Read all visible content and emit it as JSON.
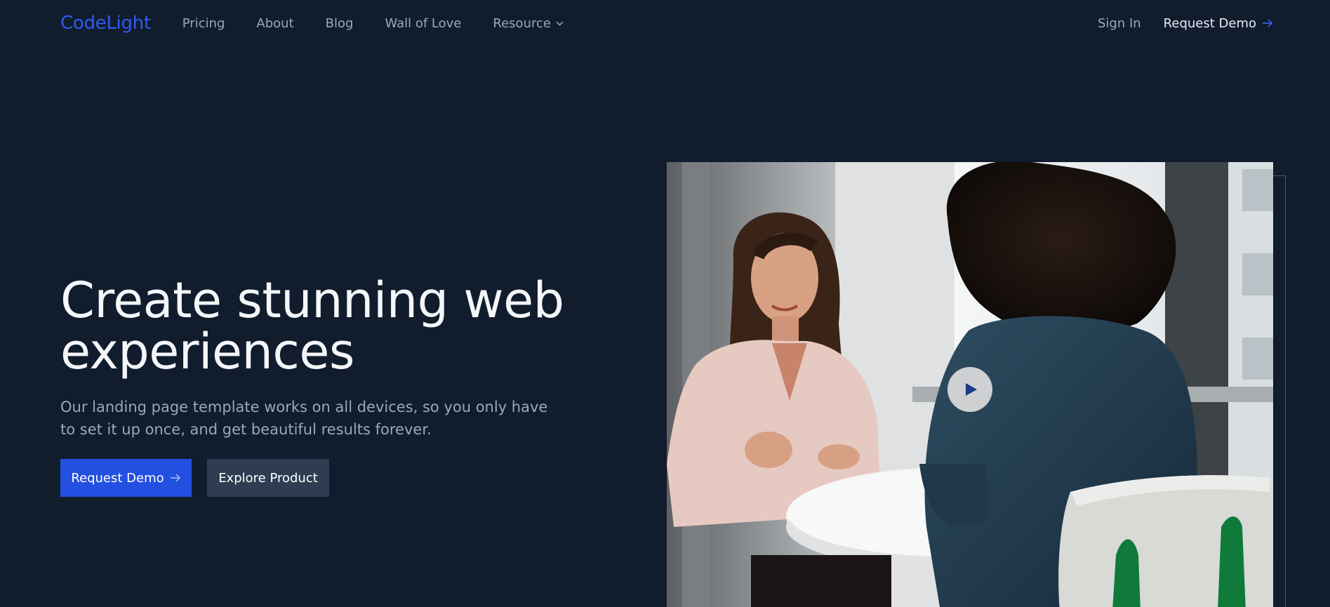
{
  "header": {
    "logo": "CodeLight",
    "nav": [
      {
        "label": "Pricing"
      },
      {
        "label": "About"
      },
      {
        "label": "Blog"
      },
      {
        "label": "Wall of Love"
      },
      {
        "label": "Resource",
        "icon": "chevron-down-icon"
      }
    ],
    "sign_in": "Sign In",
    "request_demo": "Request Demo"
  },
  "hero": {
    "title_line1": "Create stunning web",
    "title_line2": "experiences",
    "subtitle": "Our landing page template works on all devices, so you only have to set it up once, and get beautiful results forever.",
    "primary_button": "Request Demo",
    "secondary_button": "Explore Product"
  },
  "media": {
    "image_subject": "two women talking at a round white table by a window",
    "play_icon": "play-icon"
  },
  "colors": {
    "background": "#111c2d",
    "brand": "#2f5cf0",
    "primary_button": "#2350e0",
    "secondary_button": "#2e3d52",
    "muted_text": "#9aa8bd"
  }
}
